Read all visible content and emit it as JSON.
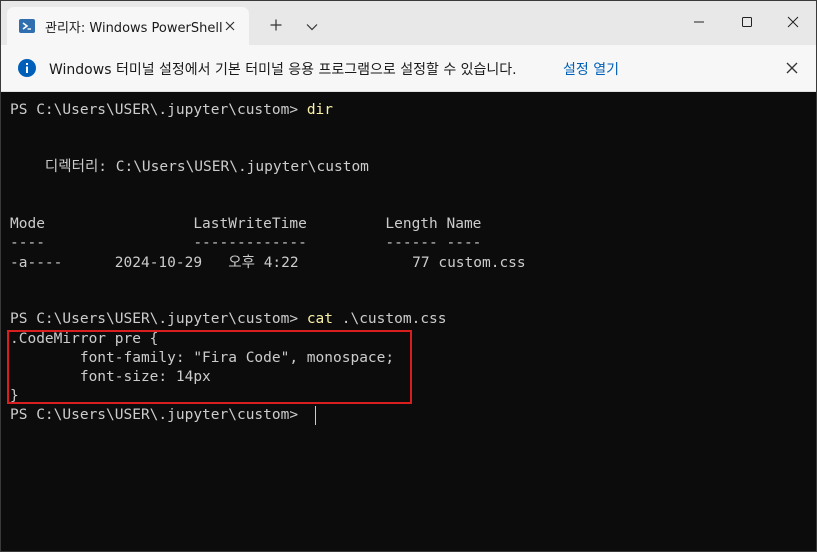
{
  "tab": {
    "title": "관리자: Windows PowerShell"
  },
  "infobar": {
    "message": "Windows 터미널 설정에서 기본 터미널 응용 프로그램으로 설정할 수 있습니다.",
    "link": "설정 열기"
  },
  "terminal": {
    "prompt": "PS C:\\Users\\USER\\.jupyter\\custom> ",
    "cmd1": "dir",
    "dir_header": "    디렉터리: C:\\Users\\USER\\.jupyter\\custom",
    "columns_header": "Mode                 LastWriteTime         Length Name",
    "columns_rule": "----                 -------------         ------ ----",
    "row": {
      "mode": "-a----",
      "date": "2024-10-29",
      "time": "오후 4:22",
      "length": "77",
      "name": "custom.css"
    },
    "cmd2": "cat",
    "cmd2_arg": " .\\custom.css",
    "css_lines": [
      ".CodeMirror pre {",
      "        font-family: \"Fira Code\", monospace;",
      "        font-size: 14px",
      "}"
    ]
  },
  "colors": {
    "terminal_bg": "#0c0c0c",
    "terminal_fg": "#cccccc",
    "command": "#f9f1a5",
    "highlight_border": "#d81e1e",
    "link": "#005fb8"
  },
  "icons": [
    "powershell-icon",
    "close-icon",
    "plus-icon",
    "chevron-down-icon",
    "minimize-icon",
    "maximize-icon",
    "info-icon"
  ]
}
